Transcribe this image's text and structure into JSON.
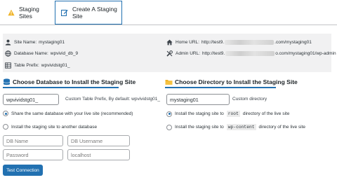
{
  "tabs": [
    {
      "label": "Staging Sites",
      "icon": "warning-icon"
    },
    {
      "label": "Create A Staging Site",
      "icon": "edit-icon"
    }
  ],
  "info": {
    "site_name_label": "Site Name:",
    "site_name_value": "mystaging01",
    "database_name_label": "Database Name:",
    "database_name_value": "wpvivid_db_9",
    "table_prefix_label": "Table Prefix:",
    "table_prefix_value": "wpvividstg01_",
    "home_url_label": "Home URL:",
    "home_url_prefix": "http://test9.",
    "home_url_suffix": ".com/mystaging01",
    "admin_url_label": "Admin URL:",
    "admin_url_prefix": "http://test9.",
    "admin_url_suffix": "o.com/mystaging01/wp-admin"
  },
  "database": {
    "heading": "Choose Database to Install the Staging Site",
    "prefix_value": "wpvividstg01_",
    "prefix_note": "Custom Table Prefix, By default: wpvividstg01_",
    "option_same": "Share the same database with your live site (recommended)",
    "option_other": "Install the staging site to another database",
    "db_name_placeholder": "DB Name",
    "db_username_placeholder": "DB Username",
    "password_placeholder": "Password",
    "host_placeholder": "localhost",
    "test_button": "Test Connection"
  },
  "directory": {
    "heading": "Choose Directory to Install the Staging Site",
    "dir_value": "mystaging01",
    "dir_note": "Custom directory",
    "option_root_pre": "Install the staging site to",
    "option_root_code": "root",
    "option_root_post": "directory of the live site",
    "option_wpcontent_pre": "Install the staging site to",
    "option_wpcontent_code": "wp-content",
    "option_wpcontent_post": "directory of the live site"
  },
  "colors": {
    "accent": "#2271b1",
    "warning_icon": "#f0b429",
    "folder_icon": "#f0b429",
    "panel_bg": "#f1f1f2"
  }
}
